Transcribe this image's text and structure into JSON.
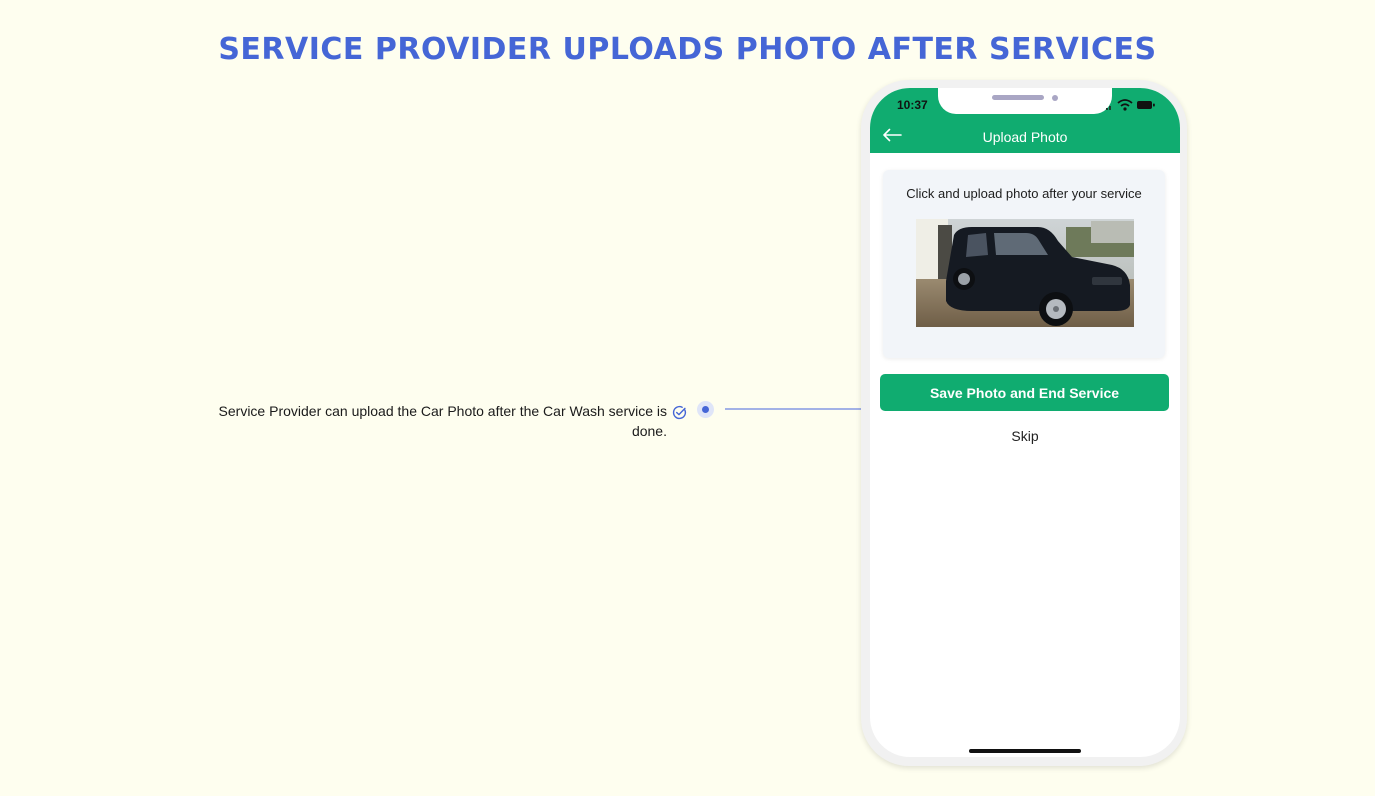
{
  "page": {
    "title": "SERVICE PROVIDER UPLOADS PHOTO AFTER SERVICES",
    "accent_color": "#4566d6",
    "background_color": "#fefeef"
  },
  "callout": {
    "text": "Service Provider can upload the Car Photo after the Car Wash service is done.",
    "icon": "check-circle-icon"
  },
  "phone": {
    "status_bar": {
      "time": "10:37",
      "icons": [
        "signal-icon",
        "wifi-icon",
        "battery-icon"
      ]
    },
    "header": {
      "title": "Upload Photo",
      "back_icon": "arrow-left-icon",
      "color": "#10ac70"
    },
    "upload_card": {
      "instructions": "Click and upload photo after your service",
      "photo": "car-photo"
    },
    "save_button": {
      "label": "Save Photo and End Service"
    },
    "skip": {
      "label": "Skip"
    }
  }
}
